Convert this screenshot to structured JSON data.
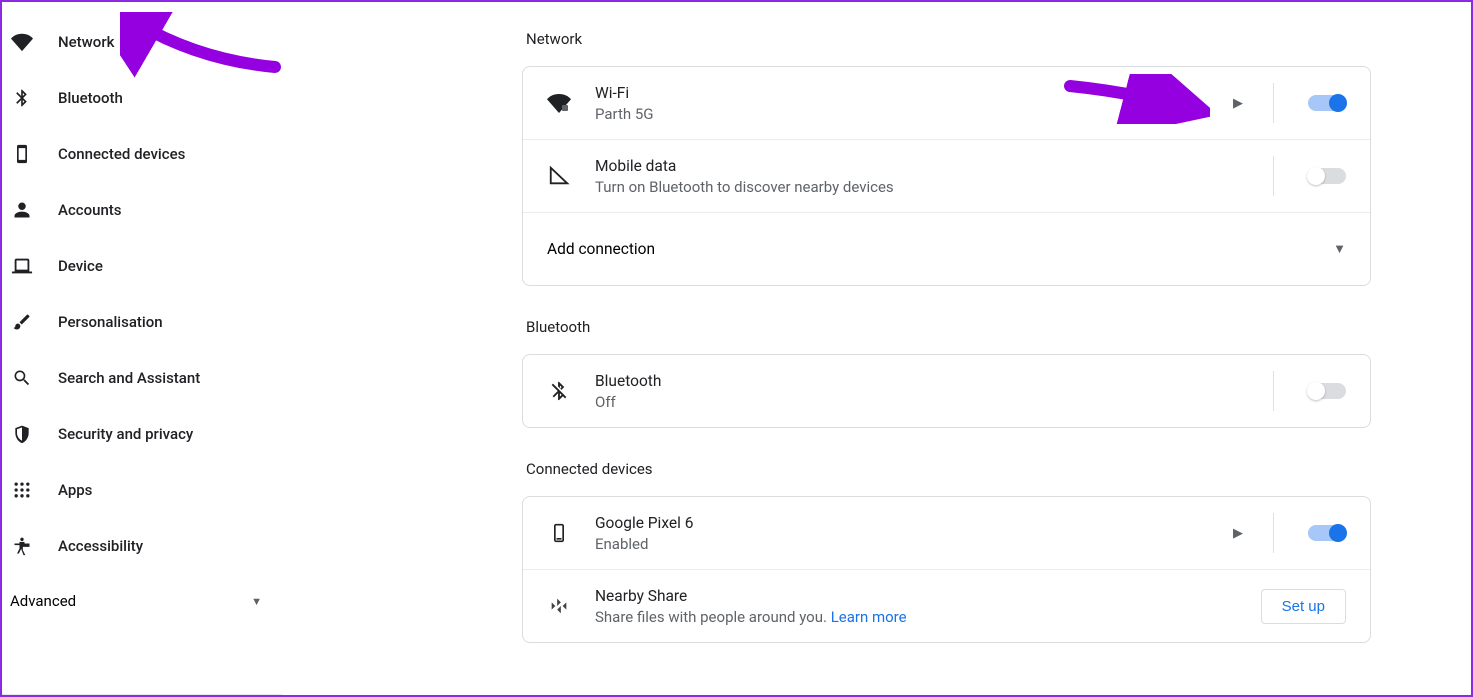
{
  "sidebar": {
    "items": [
      {
        "label": "Network",
        "icon": "wifi"
      },
      {
        "label": "Bluetooth",
        "icon": "bluetooth"
      },
      {
        "label": "Connected devices",
        "icon": "phone"
      },
      {
        "label": "Accounts",
        "icon": "person"
      },
      {
        "label": "Device",
        "icon": "laptop"
      },
      {
        "label": "Personalisation",
        "icon": "brush"
      },
      {
        "label": "Search and Assistant",
        "icon": "search"
      },
      {
        "label": "Security and privacy",
        "icon": "shield"
      },
      {
        "label": "Apps",
        "icon": "grid"
      },
      {
        "label": "Accessibility",
        "icon": "accessibility"
      }
    ],
    "advanced": "Advanced"
  },
  "sections": {
    "network": {
      "header": "Network",
      "wifi": {
        "title": "Wi-Fi",
        "subtitle": "Parth 5G",
        "toggle": true
      },
      "mobile": {
        "title": "Mobile data",
        "subtitle": "Turn on Bluetooth to discover nearby devices",
        "toggle": false
      },
      "addconn": "Add connection"
    },
    "bluetooth": {
      "header": "Bluetooth",
      "bt": {
        "title": "Bluetooth",
        "subtitle": "Off",
        "toggle": false
      }
    },
    "connected": {
      "header": "Connected devices",
      "pixel": {
        "title": "Google Pixel 6",
        "subtitle": "Enabled",
        "toggle": true
      },
      "nearby": {
        "title": "Nearby Share",
        "subtitle_pre": "Share files with people around you. ",
        "learn": "Learn more",
        "button": "Set up"
      }
    }
  }
}
